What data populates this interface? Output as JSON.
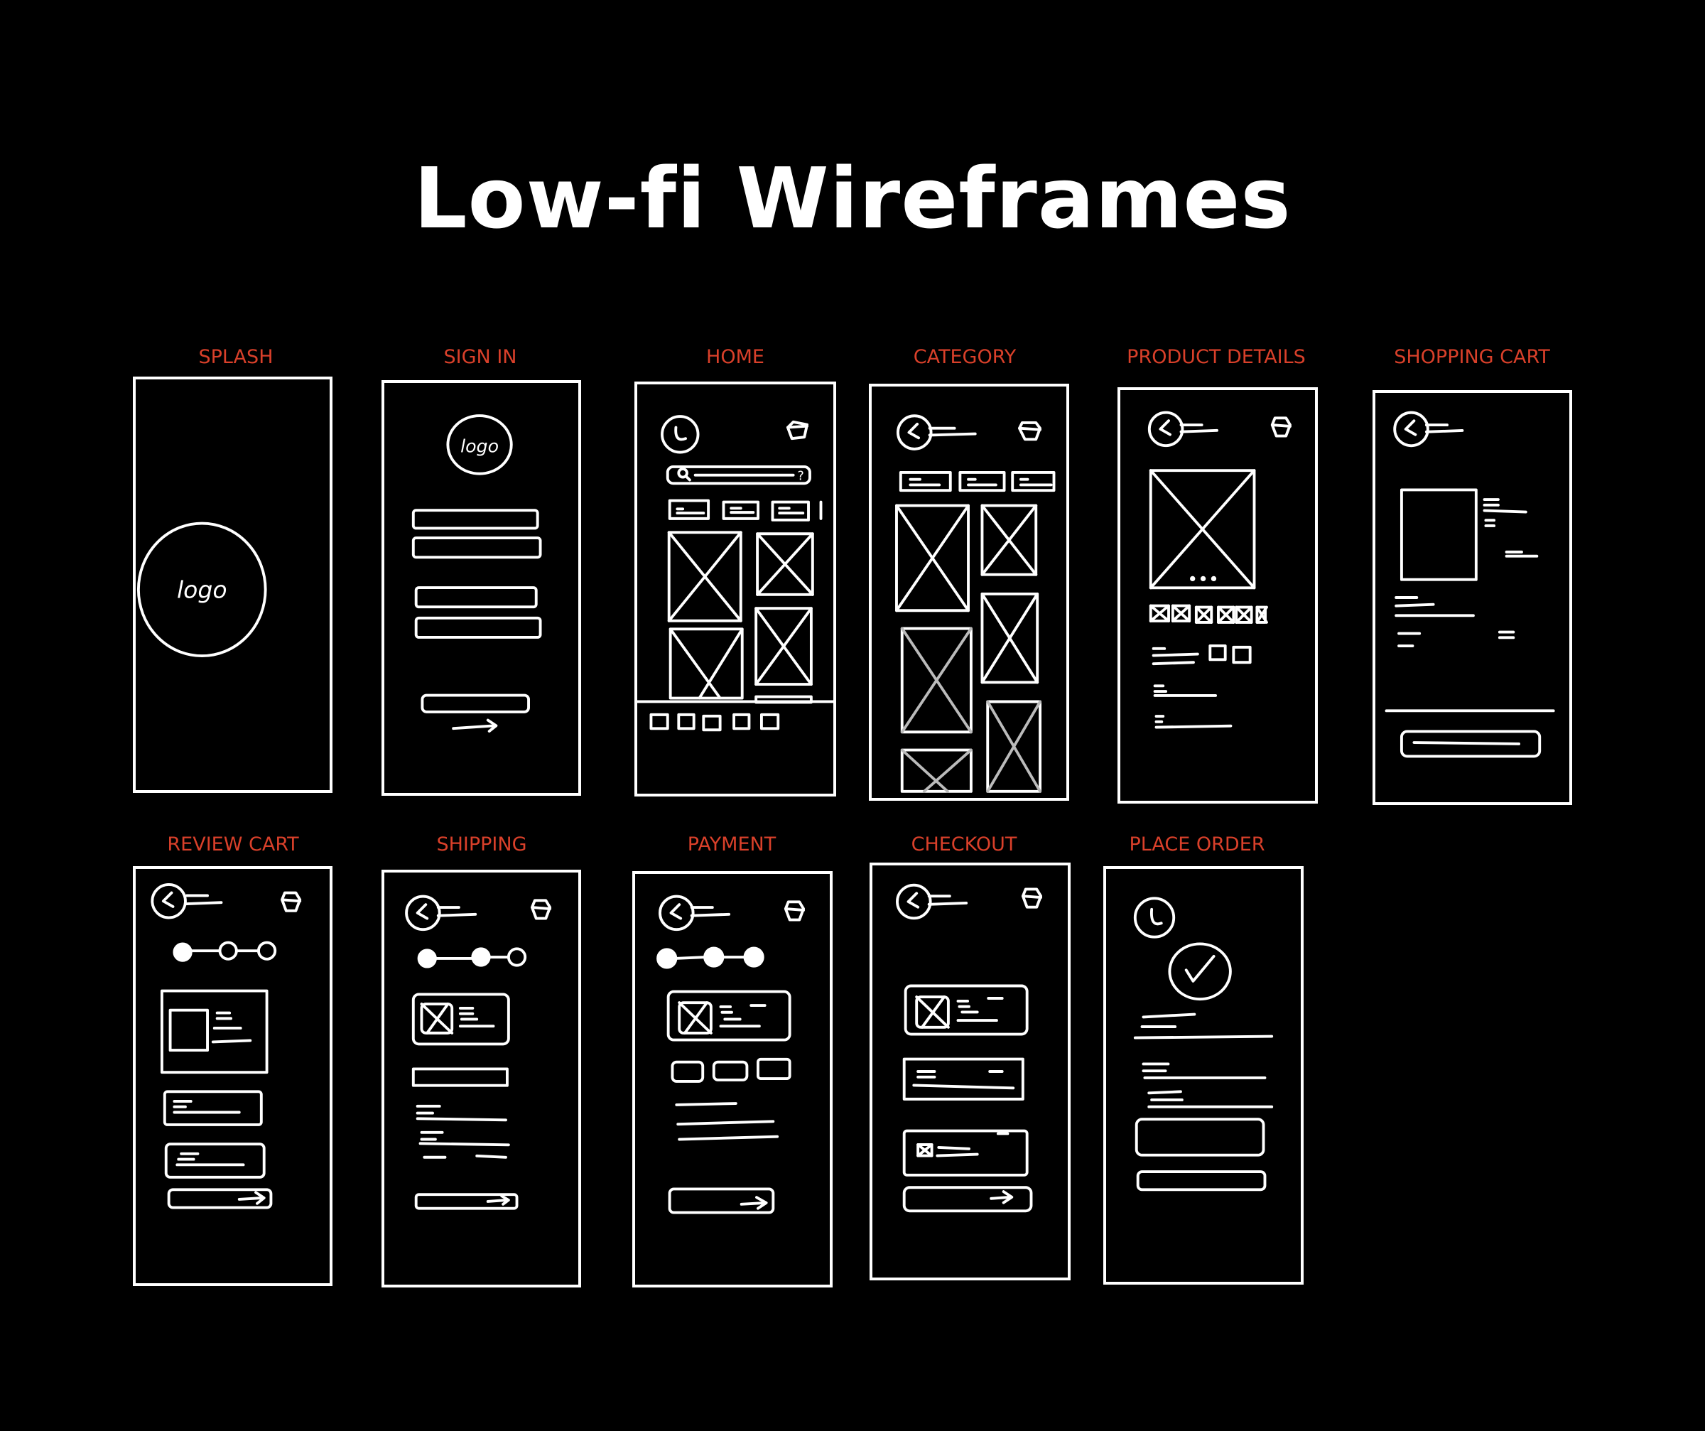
{
  "title": "Low-fi Wireframes",
  "accent_color": "#d9402a",
  "screens": [
    {
      "id": "splash",
      "label": "SPLASH",
      "logo_text": "logo"
    },
    {
      "id": "sign-in",
      "label": "SIGN IN",
      "logo_text": "logo"
    },
    {
      "id": "home",
      "label": "HOME",
      "search_hint": "?"
    },
    {
      "id": "category",
      "label": "CATEGORY"
    },
    {
      "id": "product-details",
      "label": "PRODUCT DETAILS",
      "carousel_dots": "•••"
    },
    {
      "id": "shopping-cart",
      "label": "SHOPPING CART"
    },
    {
      "id": "review-cart",
      "label": "REVIEW CART",
      "step": 1,
      "steps_total": 3
    },
    {
      "id": "shipping",
      "label": "SHIPPING",
      "step": 2,
      "steps_total": 3
    },
    {
      "id": "payment",
      "label": "PAYMENT",
      "step": 3,
      "steps_total": 3
    },
    {
      "id": "checkout",
      "label": "CHECKOUT"
    },
    {
      "id": "place-order",
      "label": "PLACE ORDER"
    }
  ]
}
